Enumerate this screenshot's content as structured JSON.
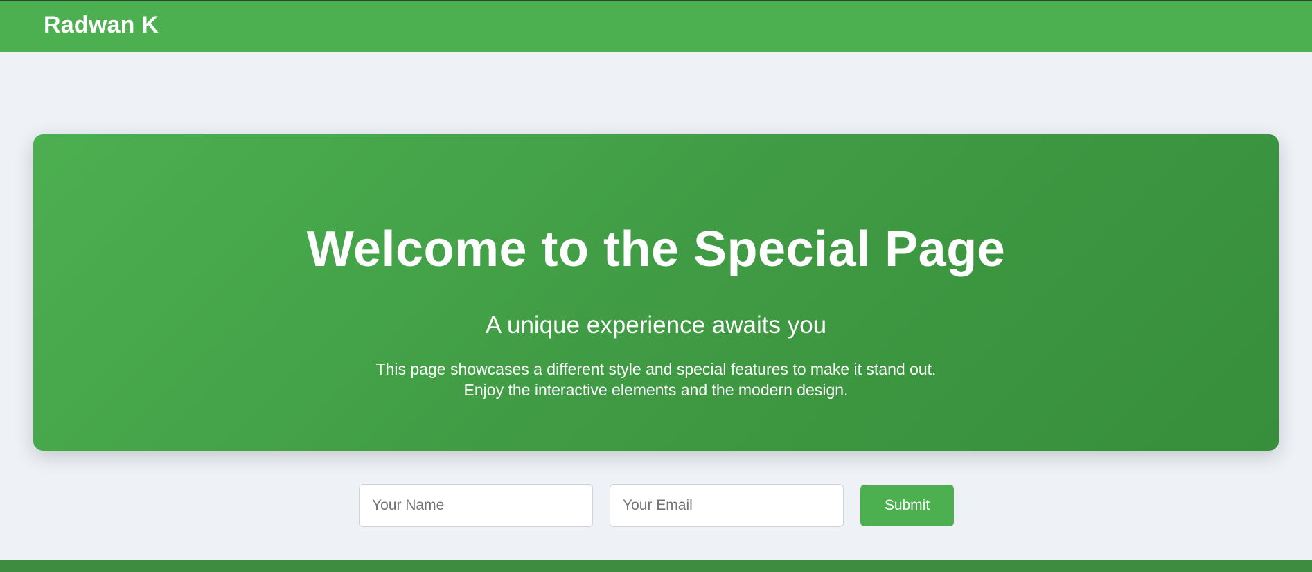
{
  "header": {
    "brand": "Radwan K"
  },
  "hero": {
    "title": "Welcome to the Special Page",
    "subtitle": "A unique experience awaits you",
    "description_line1": "This page showcases a different style and special features to make it stand out.",
    "description_line2": "Enjoy the interactive elements and the modern design."
  },
  "form": {
    "name_placeholder": "Your Name",
    "email_placeholder": "Your Email",
    "submit_label": "Submit"
  },
  "colors": {
    "primary_green": "#4caf50",
    "dark_green": "#378e3b",
    "page_background": "#eef2f7"
  }
}
